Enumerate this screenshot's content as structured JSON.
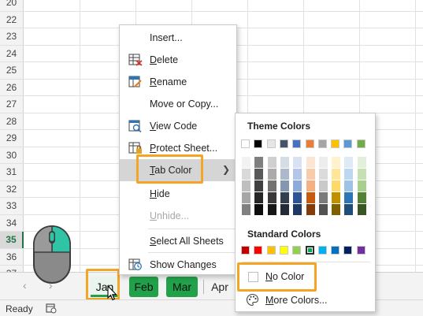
{
  "rows": [
    {
      "num": "20"
    },
    {
      "num": "22"
    },
    {
      "num": "23"
    },
    {
      "num": "24"
    },
    {
      "num": "25"
    },
    {
      "num": "26"
    },
    {
      "num": "27"
    },
    {
      "num": "28"
    },
    {
      "num": "29"
    },
    {
      "num": "30"
    },
    {
      "num": "31"
    },
    {
      "num": "32"
    },
    {
      "num": "33"
    },
    {
      "num": "34"
    },
    {
      "num": "35",
      "active": true
    },
    {
      "num": "36"
    },
    {
      "num": "37"
    },
    {
      "num": "38"
    }
  ],
  "tabs": {
    "nav_prev": "‹",
    "nav_next": "›",
    "jan": "Jan",
    "feb": "Feb",
    "mar": "Mar",
    "apr": "Apr",
    "tab_green": "#21a24a"
  },
  "status": {
    "ready": "Ready"
  },
  "context_menu": {
    "insert": "Insert...",
    "delete": "Delete",
    "rename": "Rename",
    "move_copy": "Move or Copy...",
    "view_code": "View Code",
    "protect": "Protect Sheet...",
    "tab_color": "Tab Color",
    "hide": "Hide",
    "unhide": "Unhide...",
    "select_all": "Select All Sheets",
    "show_changes": "Show Changes"
  },
  "palette": {
    "theme_title": "Theme Colors",
    "standard_title": "Standard Colors",
    "no_color": "No Color",
    "more_colors": "More Colors...",
    "theme_colors": [
      "#ffffff",
      "#000000",
      "#e7e6e6",
      "#44546a",
      "#4472c4",
      "#ed7d31",
      "#a5a5a5",
      "#ffc000",
      "#5b9bd5",
      "#70ad47"
    ],
    "theme_shades": [
      [
        "#f2f2f2",
        "#d9d9d9",
        "#bfbfbf",
        "#a6a6a6",
        "#808080"
      ],
      [
        "#7f7f7f",
        "#595959",
        "#404040",
        "#262626",
        "#0d0d0d"
      ],
      [
        "#d0cece",
        "#aeaaaa",
        "#757171",
        "#3a3838",
        "#171616"
      ],
      [
        "#d6dce4",
        "#acb9ca",
        "#8497b0",
        "#333f4f",
        "#222a35"
      ],
      [
        "#d9e2f3",
        "#b4c6e7",
        "#8eaadb",
        "#2f5496",
        "#1f3864"
      ],
      [
        "#fbe5d5",
        "#f7cbac",
        "#f4b183",
        "#c55a11",
        "#843c0b"
      ],
      [
        "#ededed",
        "#dbdbdb",
        "#c9c9c9",
        "#7b7b7b",
        "#525252"
      ],
      [
        "#fff2cc",
        "#ffe599",
        "#ffd965",
        "#bf9000",
        "#7f6000"
      ],
      [
        "#deebf6",
        "#bdd7ee",
        "#9dc3e6",
        "#2e75b5",
        "#1f4e79"
      ],
      [
        "#e2efd9",
        "#c5e0b3",
        "#a8d08d",
        "#538135",
        "#375623"
      ]
    ],
    "standard_colors": [
      "#c00000",
      "#ff0000",
      "#ffc000",
      "#ffff00",
      "#92d050",
      "#00b050",
      "#00b0f0",
      "#0070c0",
      "#002060",
      "#7030a0"
    ],
    "selected_standard_index": 5
  },
  "accent": {
    "highlight_box": "#f4a525",
    "excel_green": "#217346"
  }
}
